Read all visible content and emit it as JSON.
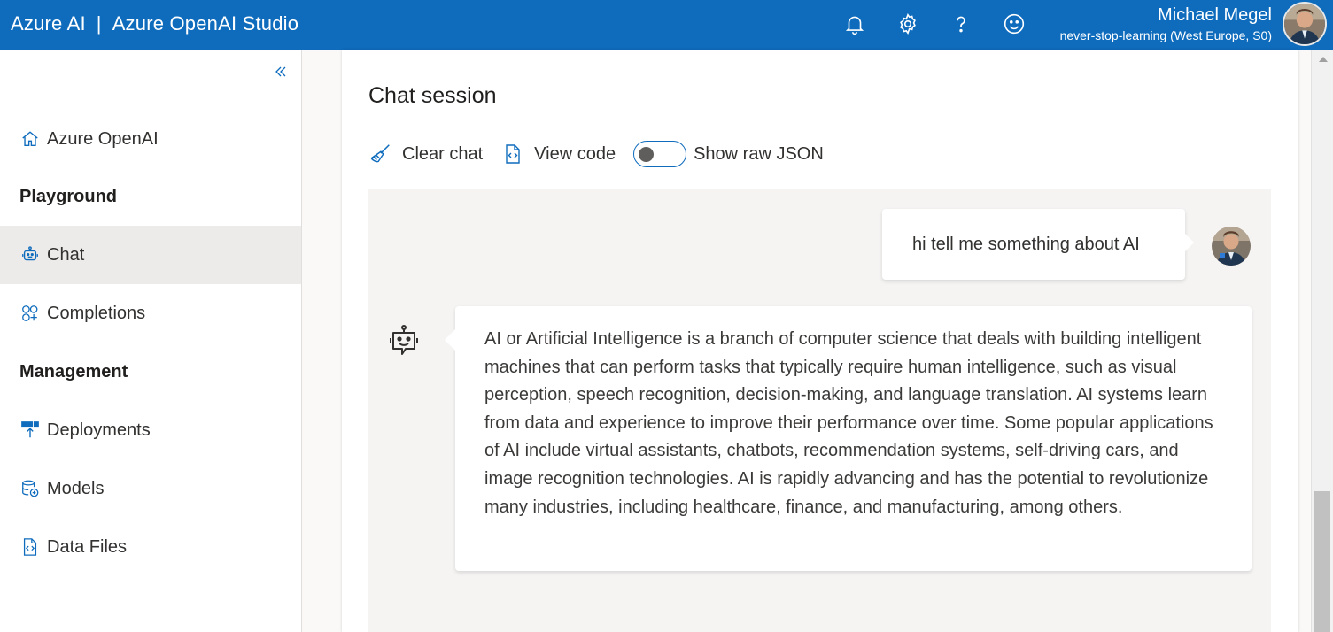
{
  "header": {
    "brand_left": "Azure AI",
    "brand_sep": "|",
    "brand_right": "Azure OpenAI Studio",
    "icons": [
      "bell-icon",
      "gear-icon",
      "help-icon",
      "smiley-icon"
    ],
    "user_name": "Michael Megel",
    "user_tenant": "never-stop-learning (West Europe, S0)",
    "accent": "#0f6cbd"
  },
  "sidebar": {
    "items": [
      {
        "label": "Azure OpenAI",
        "icon": "home-icon"
      },
      {
        "label": "Chat",
        "icon": "bot-icon",
        "active": true
      },
      {
        "label": "Completions",
        "icon": "completions-icon"
      },
      {
        "label": "Deployments",
        "icon": "deployments-icon"
      },
      {
        "label": "Models",
        "icon": "models-icon"
      },
      {
        "label": "Data Files",
        "icon": "data-files-icon"
      }
    ],
    "section_playground": "Playground",
    "section_management": "Management"
  },
  "main": {
    "title": "Chat session",
    "toolbar": {
      "clear_chat": "Clear chat",
      "view_code": "View code",
      "show_raw_json": "Show raw JSON",
      "raw_json_enabled": false
    },
    "messages": {
      "user": "hi tell me something about AI",
      "assistant": "AI or Artificial Intelligence is a branch of computer science that deals with building intelligent machines that can perform tasks that typically require human intelligence, such as visual perception, speech recognition, decision-making, and language translation. AI systems learn from data and experience to improve their performance over time. Some popular applications of AI include virtual assistants, chatbots, recommendation systems, self-driving cars, and image recognition technologies. AI is rapidly advancing and has the potential to revolutionize many industries, including healthcare, finance, and manufacturing, among others."
    }
  }
}
